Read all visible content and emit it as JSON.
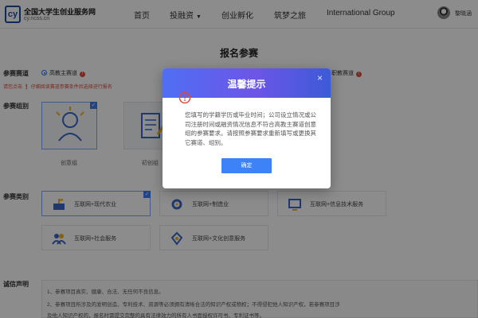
{
  "header": {
    "logo_mark": "cy",
    "logo_title": "全国大学生创业服务网",
    "logo_subtitle": "cy.ncss.cn",
    "nav": [
      "首页",
      "投融资",
      "创业孵化",
      "筑梦之旅",
      "International Group"
    ],
    "user_name": "黎晓涵"
  },
  "page": {
    "title": "报名参赛",
    "track_label": "参赛赛道",
    "track_options": [
      "高教主赛道",
      "职教赛道"
    ],
    "track_hint": "请您点击  ❗ 仔细阅读赛道参赛条件后选择进行报名",
    "group_label": "参赛组别",
    "groups": [
      "创意组",
      "初创组"
    ],
    "category_label": "参赛类别",
    "categories": [
      "互联网+现代农业",
      "互联网+制造业",
      "互联网+信息技术服务",
      "互联网+社会服务",
      "互联网+文化创意服务"
    ],
    "declaration_label": "诚信声明",
    "declaration_lines": [
      "1、参赛项目真实、健康、合法、无任何不良信息。",
      "2、参赛项目所涉及的发明创造、专利技术、资源等必须拥有清晰合法的知识产权或物权；不得侵犯他人知识产权，若参赛项目涉",
      "及他人知识产权的，报名时需提交完整的具有法律效力的所有人书面授权许可书、专利证书等。"
    ]
  },
  "modal": {
    "title": "温馨提示",
    "close_glyph": "×",
    "message": "您填写的学籍学历或毕业时间；公司设立情况或公司注册时间或融资情况信息不符合高教主赛道创意组的参赛要求。请按照参赛要求重新填写或更换其它赛道、组别。",
    "confirm_label": "确定"
  },
  "colors": {
    "accent": "#3e82f7",
    "modal_gradient_start": "#4f6ff3",
    "modal_gradient_end": "#6d55e8",
    "warning": "#e2493b"
  }
}
